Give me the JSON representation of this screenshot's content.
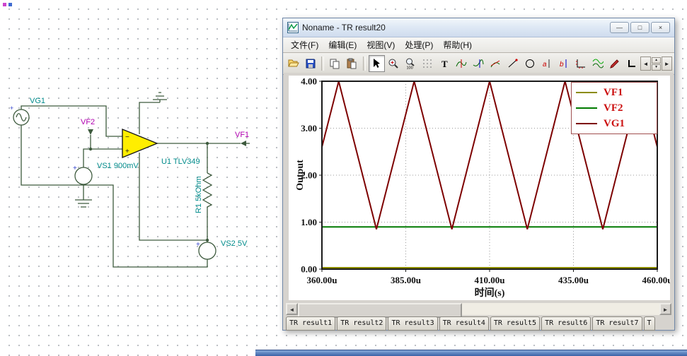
{
  "schematic": {
    "labels": {
      "vg1": "VG1",
      "vf2": "VF2",
      "vf1": "VF1",
      "vs1": "VS1 900mV",
      "u1": "U1 TLV349",
      "r1": "R1 5kOhm",
      "vs2": "VS2 5V"
    },
    "colors": {
      "component_label": "#008b8b",
      "probe_label": "#b000b0",
      "opamp_fill": "#ffee00",
      "wire": "#3d5a3d"
    }
  },
  "window": {
    "title": "Noname - TR result20",
    "controls": {
      "minimize": "—",
      "maximize": "□",
      "close": "×"
    }
  },
  "menu": {
    "items": [
      {
        "label": "文件(F)"
      },
      {
        "label": "编辑(E)"
      },
      {
        "label": "视图(V)"
      },
      {
        "label": "处理(P)"
      },
      {
        "label": "帮助(H)"
      }
    ]
  },
  "toolbar": {
    "buttons": [
      {
        "name": "open"
      },
      {
        "name": "save"
      },
      {
        "name": "copy"
      },
      {
        "name": "paste"
      },
      {
        "name": "select-cursor"
      },
      {
        "name": "zoom-in"
      },
      {
        "name": "zoom-100"
      },
      {
        "name": "grid"
      },
      {
        "name": "insert-text"
      },
      {
        "name": "interpolate"
      },
      {
        "name": "smooth"
      },
      {
        "name": "tangent"
      },
      {
        "name": "slope"
      },
      {
        "name": "circle"
      },
      {
        "name": "cursor-a"
      },
      {
        "name": "cursor-b"
      },
      {
        "name": "axes"
      },
      {
        "name": "curve-style"
      },
      {
        "name": "pen"
      },
      {
        "name": "corner"
      }
    ],
    "nav": {
      "prev": "◄",
      "next": "►",
      "up": "▲",
      "down": "▼"
    }
  },
  "chart_data": {
    "type": "line",
    "title": "",
    "xlabel": "时间(s)",
    "ylabel": "Output",
    "xlim": [
      360,
      460
    ],
    "ylim": [
      0,
      4
    ],
    "x_unit": "u",
    "grid": "dotted",
    "legend_position": "top-right",
    "legend_text_color": "#cc1111",
    "xticks": {
      "values": [
        360,
        385,
        410,
        435,
        460
      ],
      "labels": [
        "360.00u",
        "385.00u",
        "410.00u",
        "435.00u",
        "460.00u"
      ]
    },
    "yticks": {
      "values": [
        0,
        1,
        2,
        3,
        4
      ],
      "labels": [
        "0.00",
        "1.00",
        "2.00",
        "3.00",
        "4.00"
      ]
    },
    "series": [
      {
        "name": "VF1",
        "color": "#8b8b00",
        "width": 2,
        "points": [
          [
            360,
            0.03
          ],
          [
            460,
            0.03
          ]
        ]
      },
      {
        "name": "VF2",
        "color": "#007a00",
        "width": 2,
        "points": [
          [
            360,
            0.9
          ],
          [
            460,
            0.9
          ]
        ]
      },
      {
        "name": "VG1",
        "color": "#7d0000",
        "width": 2,
        "points": [
          [
            360,
            2.6
          ],
          [
            365,
            4.0
          ],
          [
            376.25,
            0.85
          ],
          [
            387.5,
            4.0
          ],
          [
            398.75,
            0.85
          ],
          [
            410,
            4.0
          ],
          [
            421.25,
            0.85
          ],
          [
            432.5,
            4.0
          ],
          [
            443.75,
            0.85
          ],
          [
            455,
            4.0
          ],
          [
            460,
            2.6
          ]
        ]
      }
    ]
  },
  "scrollbar": {
    "left_arrow": "◄",
    "right_arrow": "►"
  },
  "tabs": {
    "items": [
      {
        "label": "TR result1"
      },
      {
        "label": "TR result2"
      },
      {
        "label": "TR result3"
      },
      {
        "label": "TR result4"
      },
      {
        "label": "TR result5"
      },
      {
        "label": "TR result6"
      },
      {
        "label": "TR result7"
      },
      {
        "label": "T"
      }
    ]
  }
}
